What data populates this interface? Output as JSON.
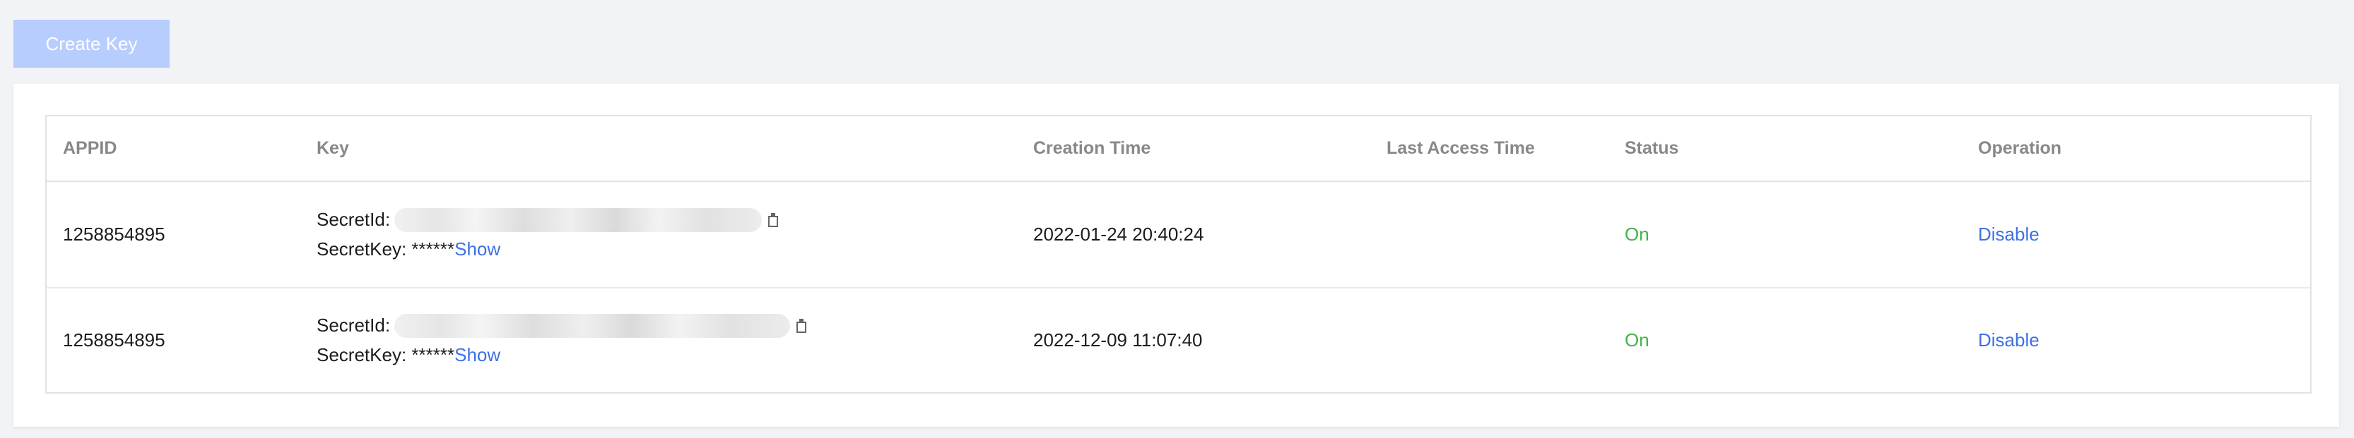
{
  "toolbar": {
    "create_key_label": "Create Key"
  },
  "table": {
    "columns": {
      "appid": "APPID",
      "key": "Key",
      "creation_time": "Creation Time",
      "last_access_time": "Last Access Time",
      "status": "Status",
      "operation": "Operation"
    },
    "rows": [
      {
        "appid": "1258854895",
        "secret_id_label": "SecretId:",
        "secret_key_label": "SecretKey: ******",
        "show_label": "Show",
        "creation_time": "2022-01-24 20:40:24",
        "last_access_time": "",
        "status": "On",
        "operation": "Disable"
      },
      {
        "appid": "1258854895",
        "secret_id_label": "SecretId:",
        "secret_key_label": "SecretKey: ******",
        "show_label": "Show",
        "creation_time": "2022-12-09 11:07:40",
        "last_access_time": "",
        "status": "On",
        "operation": "Disable"
      }
    ]
  },
  "colors": {
    "page_bg": "#f2f3f7",
    "button_bg_disabled": "#b7cdfd",
    "link": "#3d70e4",
    "status_on": "#43b24b",
    "header_text": "#888888"
  },
  "icons": {
    "copy": "copy-icon"
  }
}
